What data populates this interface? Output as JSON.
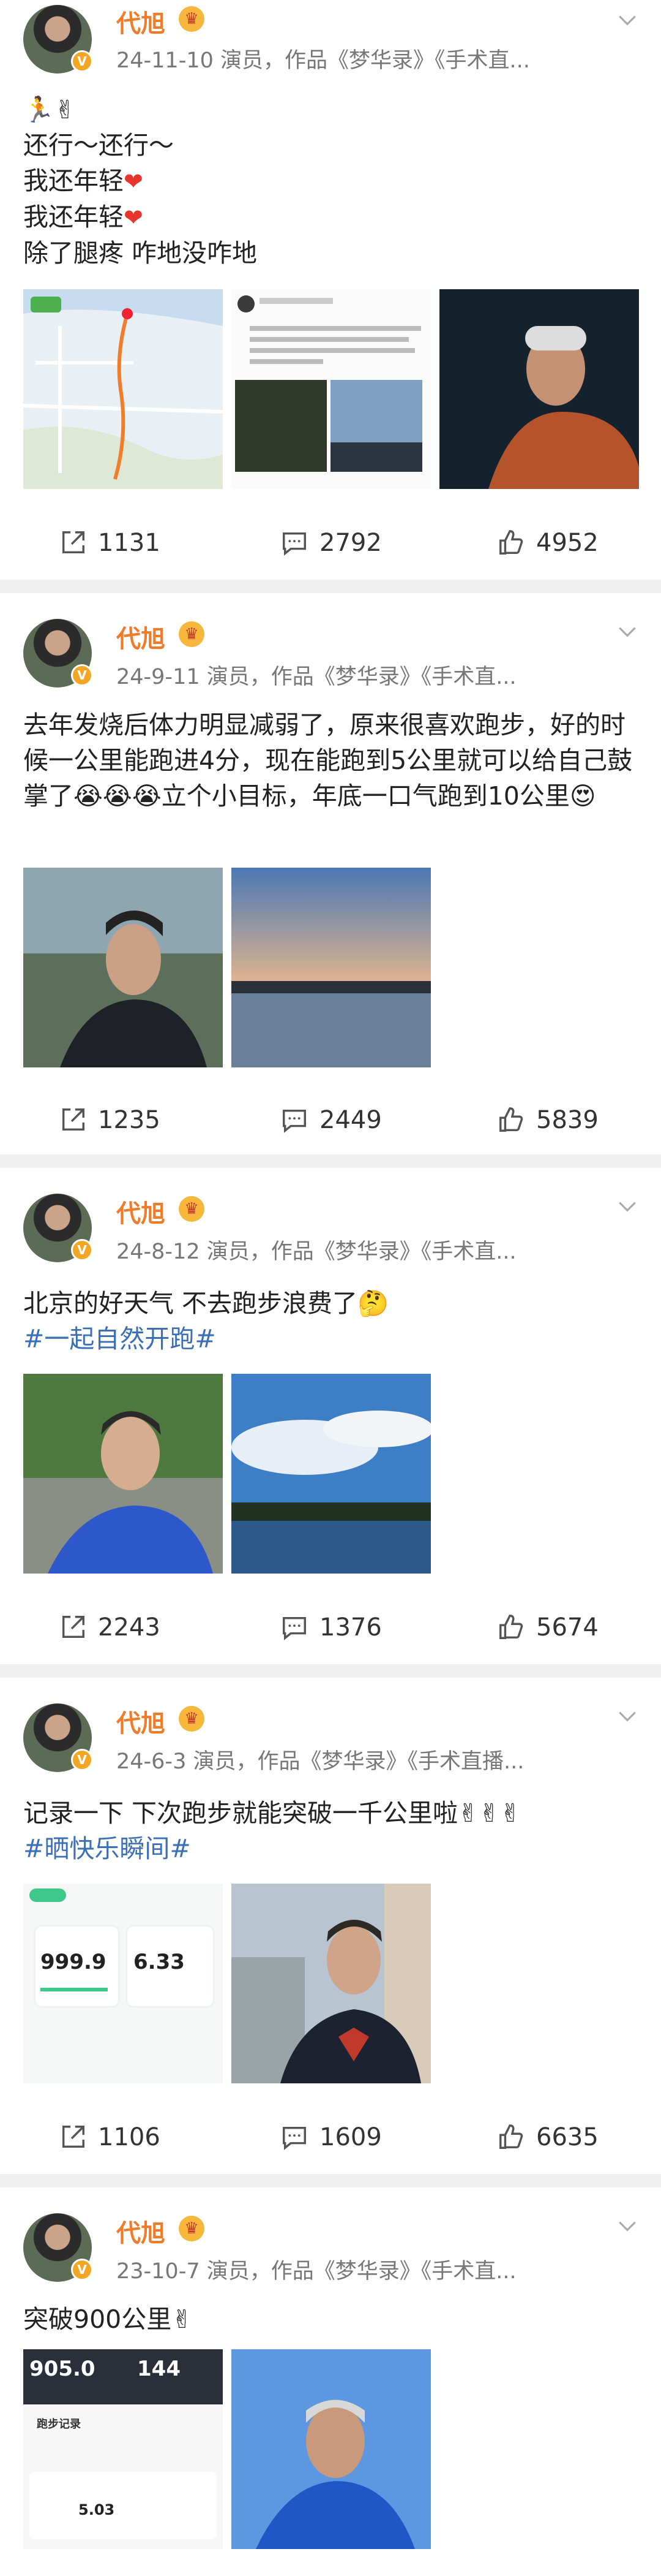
{
  "posts": [
    {
      "name": "代旭",
      "meta": "24-11-10  演员，作品《梦华录》《手术直...",
      "lines": [
        "🏃✌",
        "还行～还行～",
        "我还年轻",
        "我还年轻",
        "除了腿疼 咋地没咋地"
      ],
      "tag": "",
      "stats": {
        "share": "1131",
        "comment": "2792",
        "like": "4952"
      }
    },
    {
      "name": "代旭",
      "meta": "24-9-11  演员，作品《梦华录》《手术直...",
      "lines": [
        "去年发烧后体力明显减弱了，原来很喜欢跑步，好的时候一公里能跑进4分，现在能跑到5公里就可以给自己鼓掌了😭😭😭立个小目标，年底一口气跑到10公里😍"
      ],
      "tag": "",
      "stats": {
        "share": "1235",
        "comment": "2449",
        "like": "5839"
      }
    },
    {
      "name": "代旭",
      "meta": "24-8-12  演员，作品《梦华录》《手术直...",
      "lines": [
        "北京的好天气 不去跑步浪费了🤔"
      ],
      "tag": "#一起自然开跑#",
      "stats": {
        "share": "2243",
        "comment": "1376",
        "like": "5674"
      }
    },
    {
      "name": "代旭",
      "meta": "24-6-3  演员，作品《梦华录》《手术直播...",
      "lines": [
        "记录一下 下次跑步就能突破一千公里啦✌✌✌"
      ],
      "tag": "#晒快乐瞬间#",
      "stats": {
        "share": "1106",
        "comment": "1609",
        "like": "6635"
      }
    },
    {
      "name": "代旭",
      "meta": "23-10-7  演员，作品《梦华录》《手术直...",
      "lines": [
        "突破900公里✌"
      ],
      "tag": "",
      "stats": {}
    }
  ],
  "images": {
    "p4_stat1": "999.9",
    "p4_stat2": "6.33",
    "p5_stat1": "905.0",
    "p5_stat2": "144",
    "p5_title": "跑步记录",
    "p5_stat3": "5.03"
  },
  "colors": {
    "name": "#f07c2a",
    "tag": "#3b6fb6",
    "badge": "#f3a623"
  }
}
